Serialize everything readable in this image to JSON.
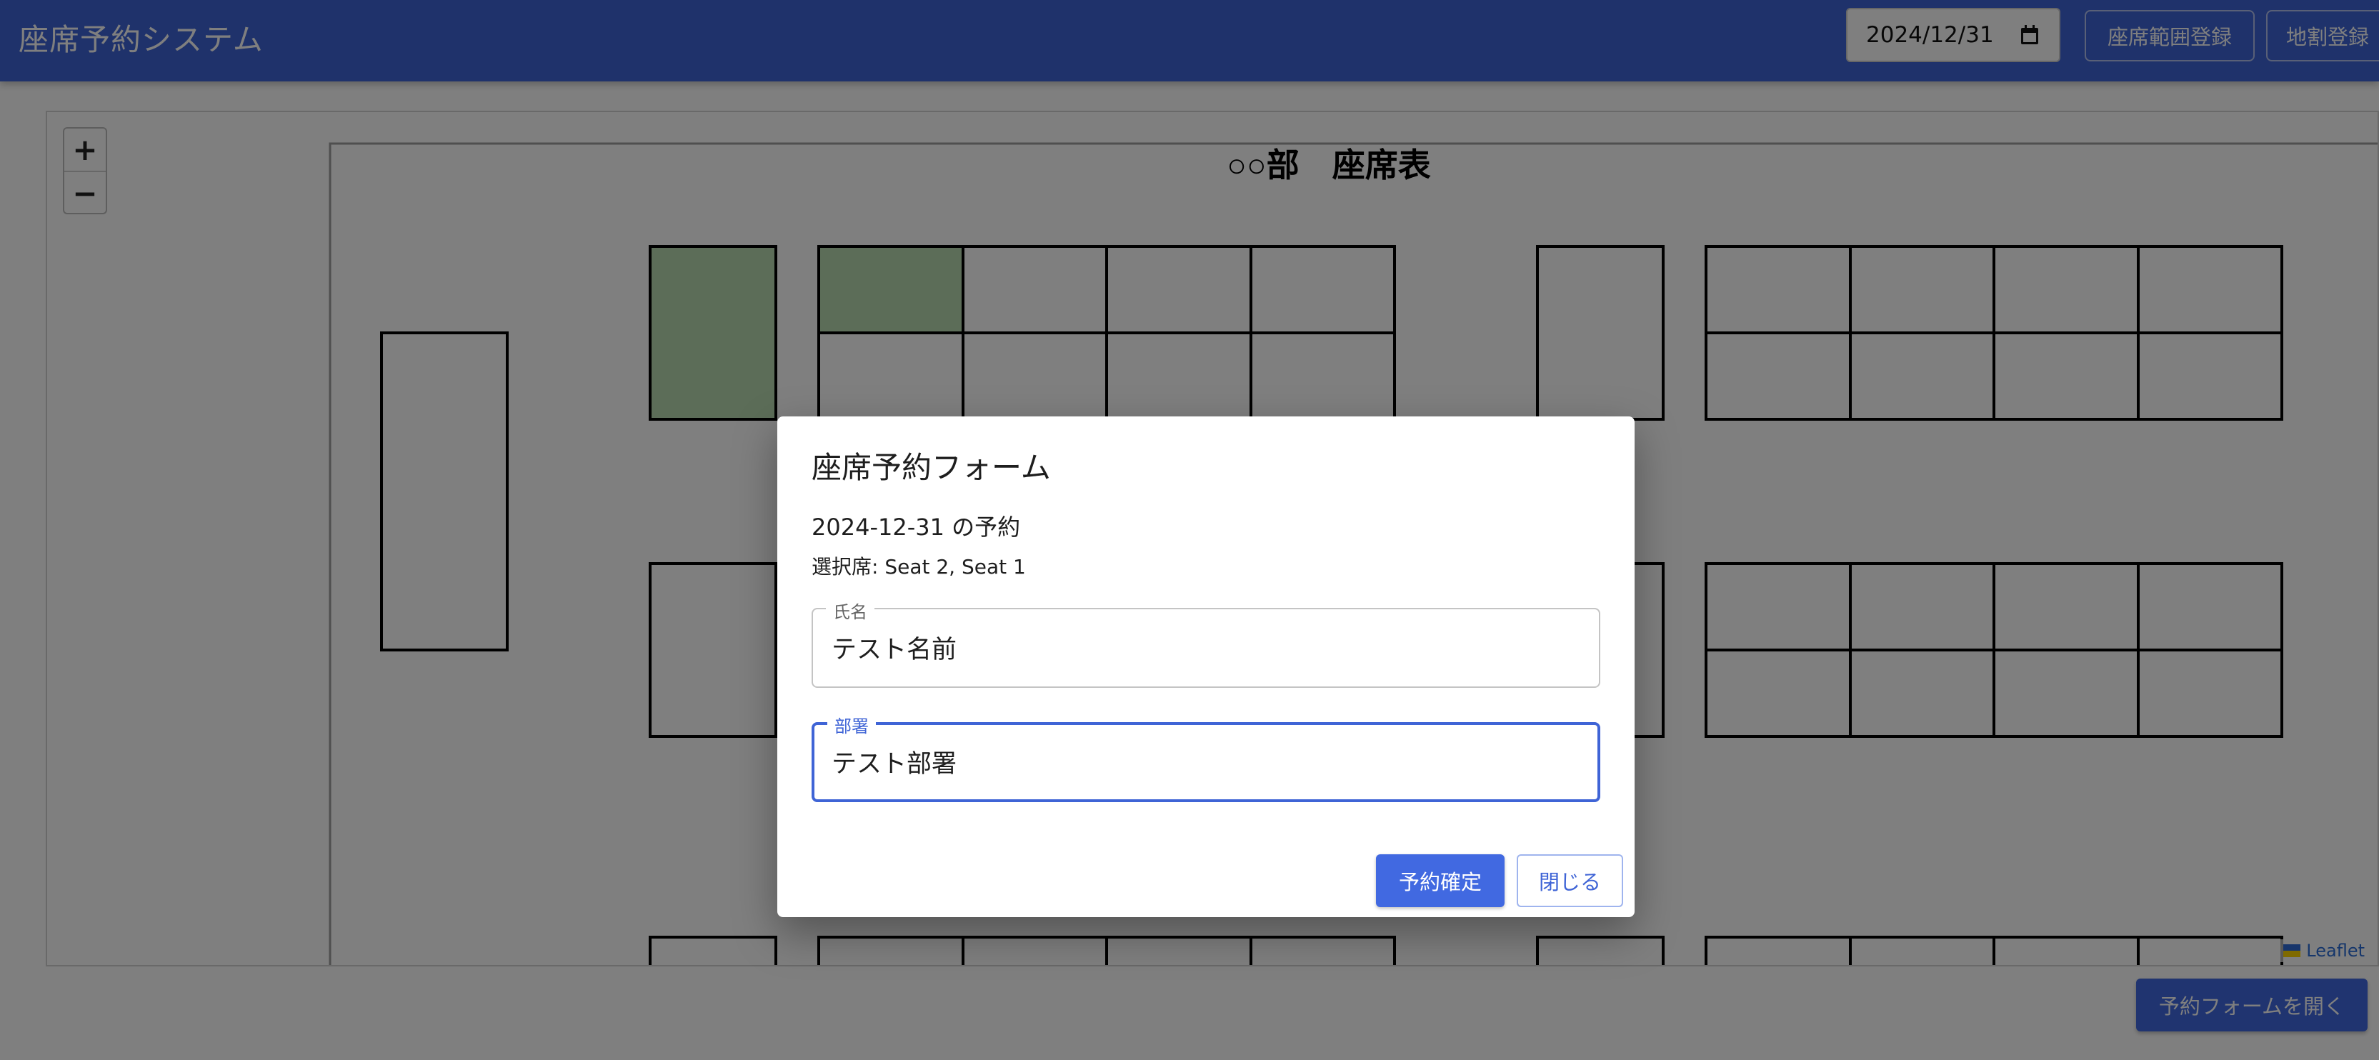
{
  "app": {
    "title": "座席予約システム"
  },
  "header": {
    "date_value": "2024/12/31",
    "buttons": [
      "座席範囲登録",
      "地割登録"
    ]
  },
  "map": {
    "floor_title": "○○部　座席表",
    "zoom_in": "+",
    "zoom_out": "−",
    "attribution": "Leaflet"
  },
  "open_form_button": "予約フォームを開く",
  "dialog": {
    "title": "座席予約フォーム",
    "date_line": "2024-12-31 の予約",
    "selected_seats": "選択席: Seat 2, Seat 1",
    "fields": [
      {
        "label": "氏名",
        "value": "テスト名前",
        "focused": false
      },
      {
        "label": "部署",
        "value": "テスト部署",
        "focused": true
      }
    ],
    "confirm_button": "予約確定",
    "close_button": "閉じる"
  },
  "colors": {
    "primary": "#3f64d6",
    "reserved_seat": "#b8dbb0",
    "backdrop": "rgba(0,0,0,0.5)"
  },
  "icons": [
    "calendar-icon",
    "ukraine-flag-icon"
  ]
}
